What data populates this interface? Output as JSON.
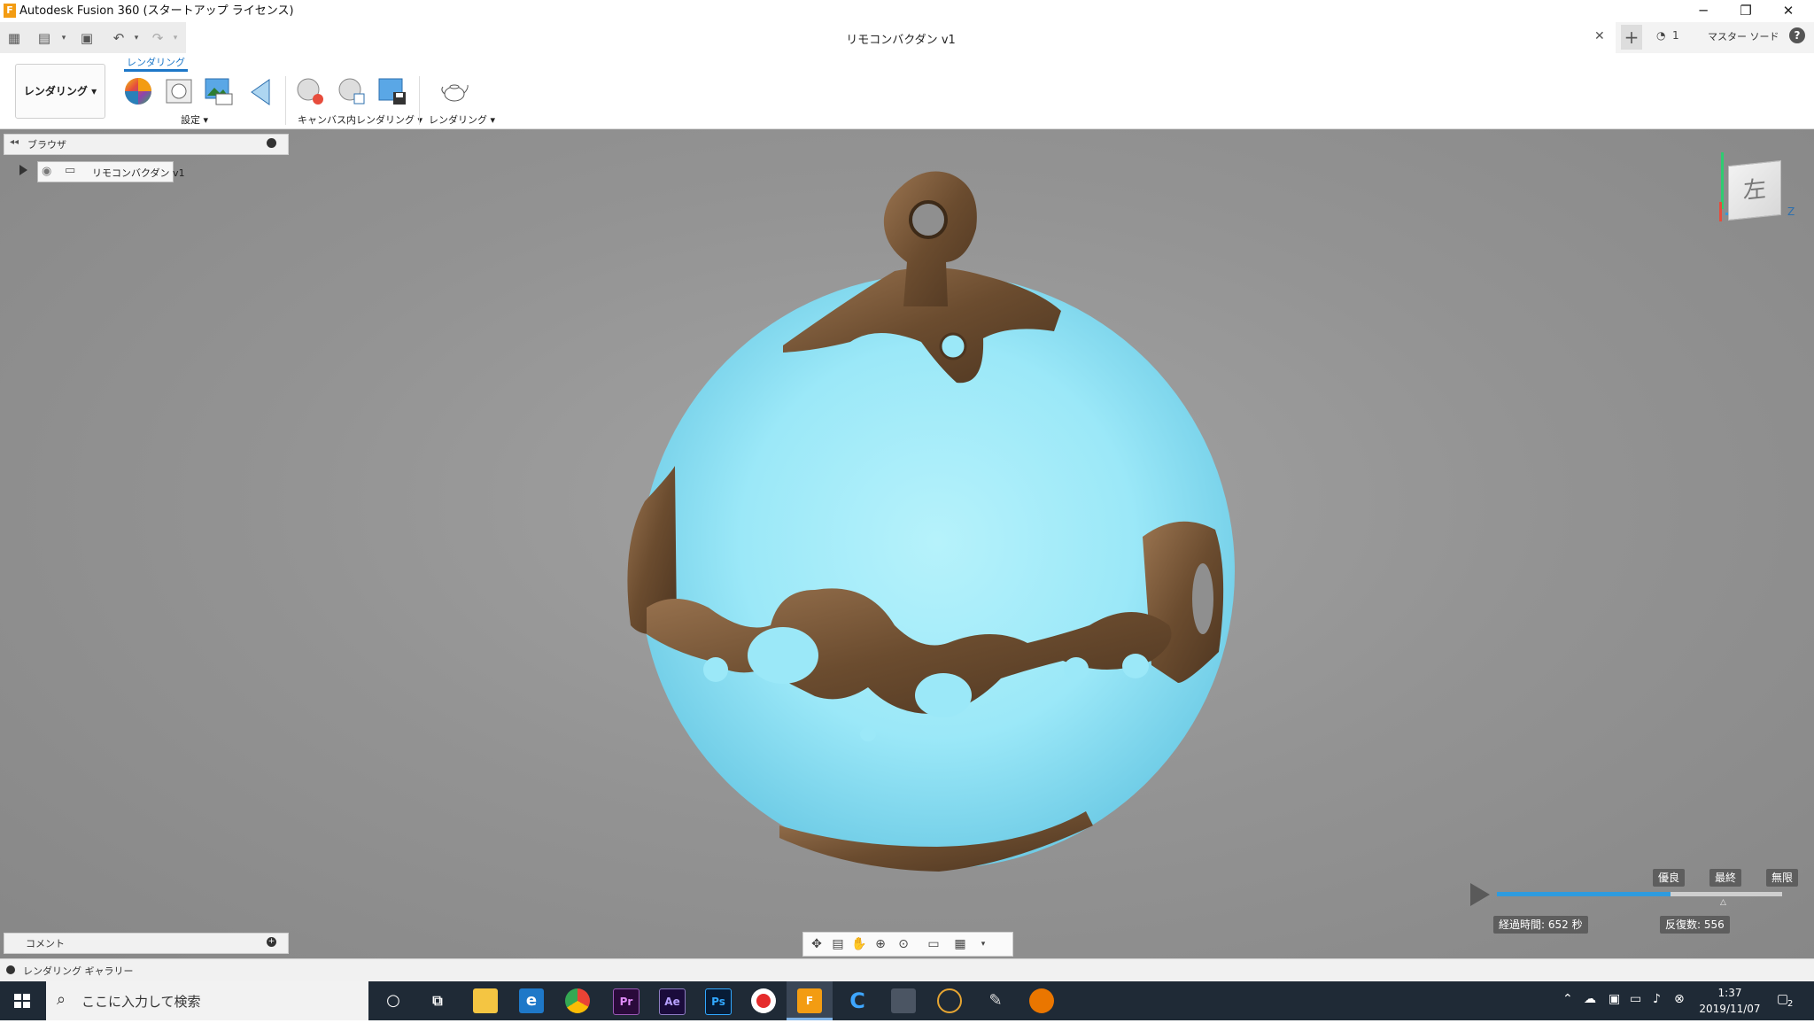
{
  "window": {
    "title": "Autodesk Fusion 360 (スタートアップ ライセンス)",
    "logo": "F",
    "minimize": "─",
    "restore": "❐",
    "close": "✕"
  },
  "tabs": {
    "doc_title": "リモコンバクダン v1",
    "close_glyph": "✕",
    "new_tab_glyph": "+",
    "jobs_count": "1",
    "master_label": "マスター ソード",
    "help_glyph": "?"
  },
  "ribbon": {
    "workspace_label": "レンダリング ▾",
    "active_tab": "レンダリング",
    "groups": {
      "setup": "設定 ▾",
      "canvas_render": "キャンバス内レンダリング ▾",
      "render": "レンダリング ▾"
    }
  },
  "browser": {
    "title": "ブラウザ",
    "item_label": "リモコンバクダン v1"
  },
  "comments": {
    "title": "コメント"
  },
  "gallery": {
    "title": "レンダリング ギャラリー"
  },
  "viewcube": {
    "face_label": "左",
    "axis_z": "Z"
  },
  "render": {
    "levels": [
      "優良",
      "最終",
      "無限"
    ],
    "progress": 0.61,
    "elapsed": "経過時間: 652 秒",
    "iterations": "反復数: 556"
  },
  "taskbar": {
    "search_placeholder": "ここに入力して検索",
    "time": "1:37",
    "date": "2019/11/07",
    "notifications": "2",
    "apps": [
      "Pr",
      "Ae",
      "Ps",
      "F"
    ]
  },
  "colors": {
    "accent": "#1e78c8",
    "viewport_bg": "#8f8f8f",
    "sphere": "#8fe3f5",
    "metal": "#7a5a3a",
    "progress": "#2e9bde"
  }
}
